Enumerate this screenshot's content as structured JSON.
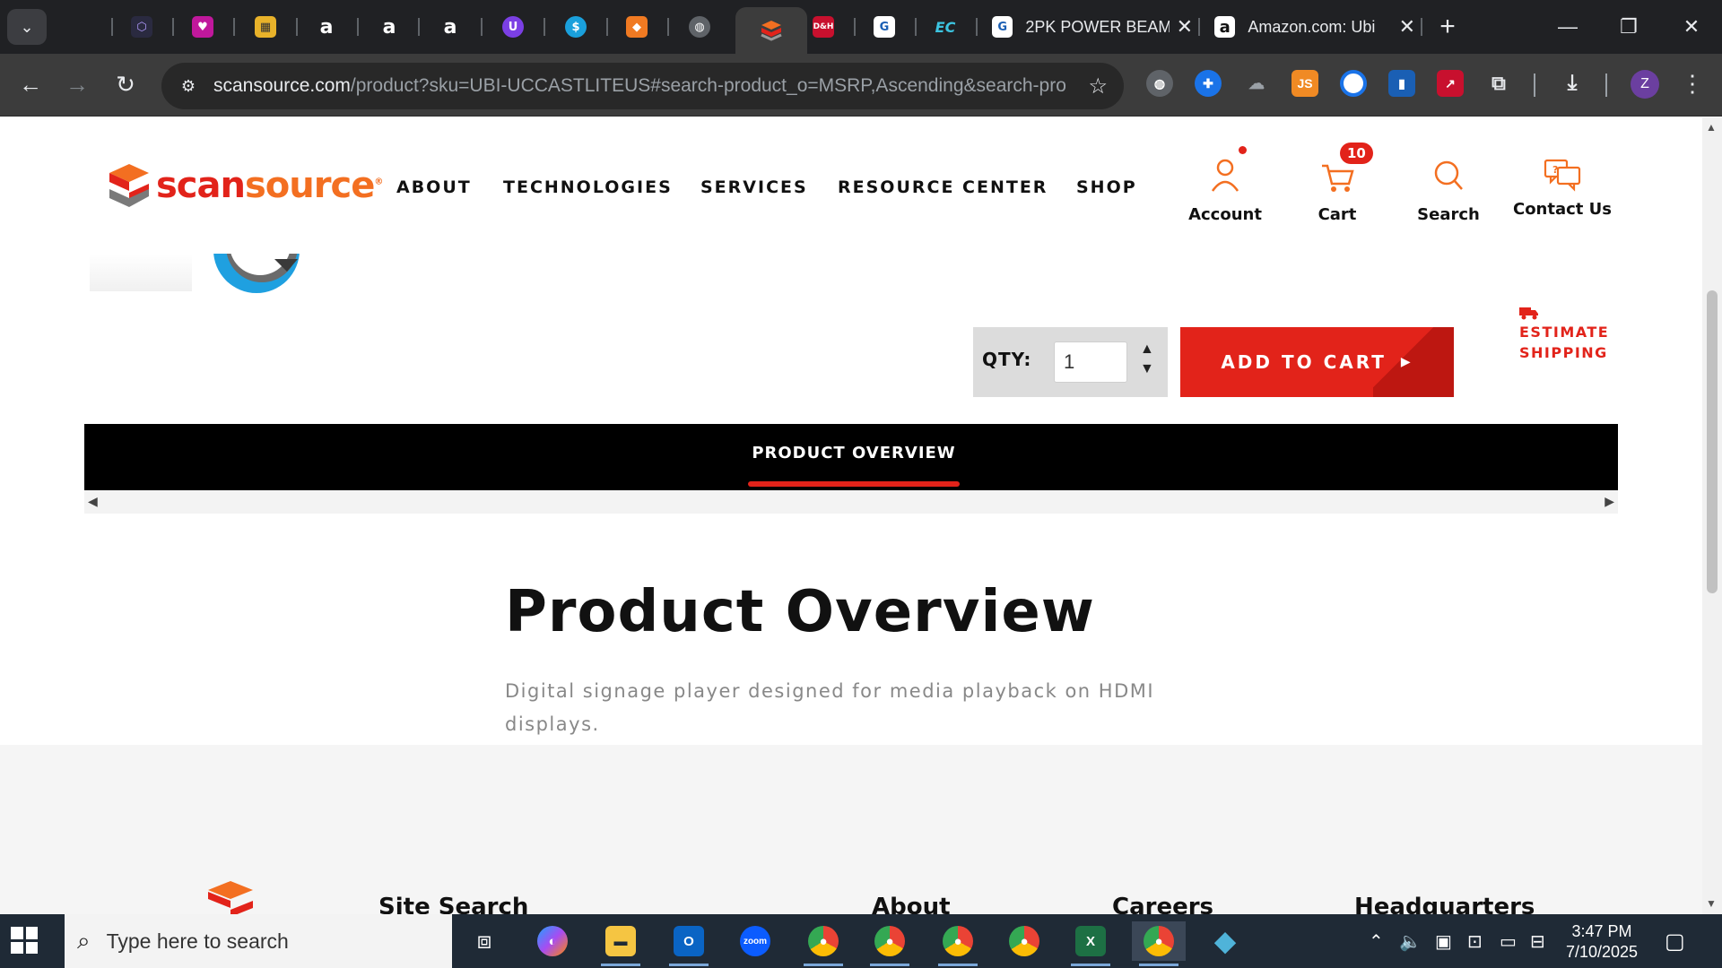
{
  "browser": {
    "tabs": [
      {
        "title": "2PK POWER BEAM",
        "favicon": "blue-g-icon"
      },
      {
        "title": "Amazon.com: Ubi",
        "favicon": "amazon-icon"
      }
    ],
    "url_host": "scansource.com",
    "url_path": "/product?sku=UBI-UCCASTLITEUS#search-product_o=MSRP,Ascending&search-prod...",
    "profile_initial": "Z",
    "ext_js_label": "JS",
    "pinned_dh_label": "D&H",
    "pinned_ec_label": "EC"
  },
  "site": {
    "logo_text_scan": "scan",
    "logo_text_source": "source",
    "logo_reg": "®",
    "nav": [
      "ABOUT",
      "TECHNOLOGIES",
      "SERVICES",
      "RESOURCE CENTER",
      "SHOP"
    ],
    "utility": {
      "account": "Account",
      "cart": "Cart",
      "cart_count": "10",
      "search": "Search",
      "contact": "Contact Us"
    }
  },
  "product": {
    "qty_label": "QTY:",
    "qty_value": "1",
    "add_to_cart": "ADD TO CART",
    "estimate_shipping_line1": "ESTIMATE",
    "estimate_shipping_line2": "SHIPPING",
    "tab_overview": "PRODUCT OVERVIEW",
    "overview_title": "Product Overview",
    "overview_desc": "Digital signage player designed for media playback on HDMI displays."
  },
  "footer": {
    "headings": [
      "Site Search",
      "About",
      "Careers",
      "Headquarters"
    ]
  },
  "taskbar": {
    "search_placeholder": "Type here to search",
    "time": "3:47 PM",
    "date": "7/10/2025",
    "zoom_label": "zoom",
    "excel_label": "X"
  },
  "colors": {
    "brand_red": "#e2231a",
    "brand_orange": "#f36f21"
  }
}
